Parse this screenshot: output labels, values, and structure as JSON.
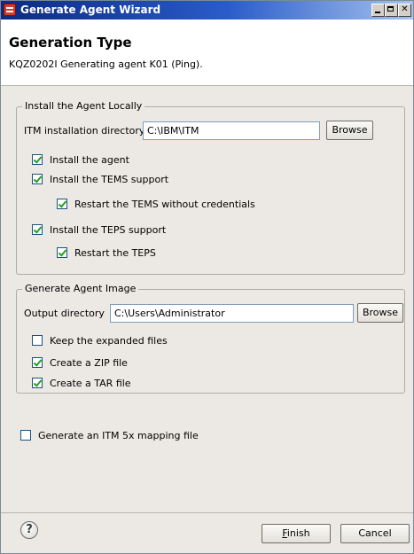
{
  "window": {
    "title": "Generate Agent Wizard"
  },
  "header": {
    "title": "Generation Type",
    "message": "KQZ0202I Generating agent K01 (Ping)."
  },
  "install_group": {
    "title": "Install the Agent Locally",
    "dir_label": "ITM installation directory",
    "dir_value": "C:\\IBM\\ITM",
    "browse_label": "Browse",
    "options": {
      "install_agent": {
        "label": "Install the agent",
        "checked": true
      },
      "install_tems": {
        "label": "Install the TEMS support",
        "checked": true
      },
      "restart_tems": {
        "label": "Restart the TEMS without credentials",
        "checked": true
      },
      "install_teps": {
        "label": "Install the TEPS support",
        "checked": true
      },
      "restart_teps": {
        "label": "Restart the TEPS",
        "checked": true
      }
    }
  },
  "image_group": {
    "title": "Generate Agent Image",
    "dir_label": "Output directory",
    "dir_value": "C:\\Users\\Administrator",
    "browse_label": "Browse",
    "options": {
      "keep_expanded": {
        "label": "Keep the expanded files",
        "checked": false
      },
      "create_zip": {
        "label": "Create a ZIP file",
        "checked": true
      },
      "create_tar": {
        "label": "Create a TAR file",
        "checked": true
      }
    }
  },
  "mapping_option": {
    "label": "Generate an ITM 5x mapping file",
    "checked": false
  },
  "footer": {
    "help_glyph": "?",
    "finish_rest": "inish",
    "finish_mnemonic": "F",
    "cancel_label": "Cancel"
  },
  "icons": {
    "app": "wizard-app-icon",
    "help": "help-icon",
    "minimize": "minimize-icon",
    "maximize": "maximize-icon",
    "close": "close-icon"
  }
}
